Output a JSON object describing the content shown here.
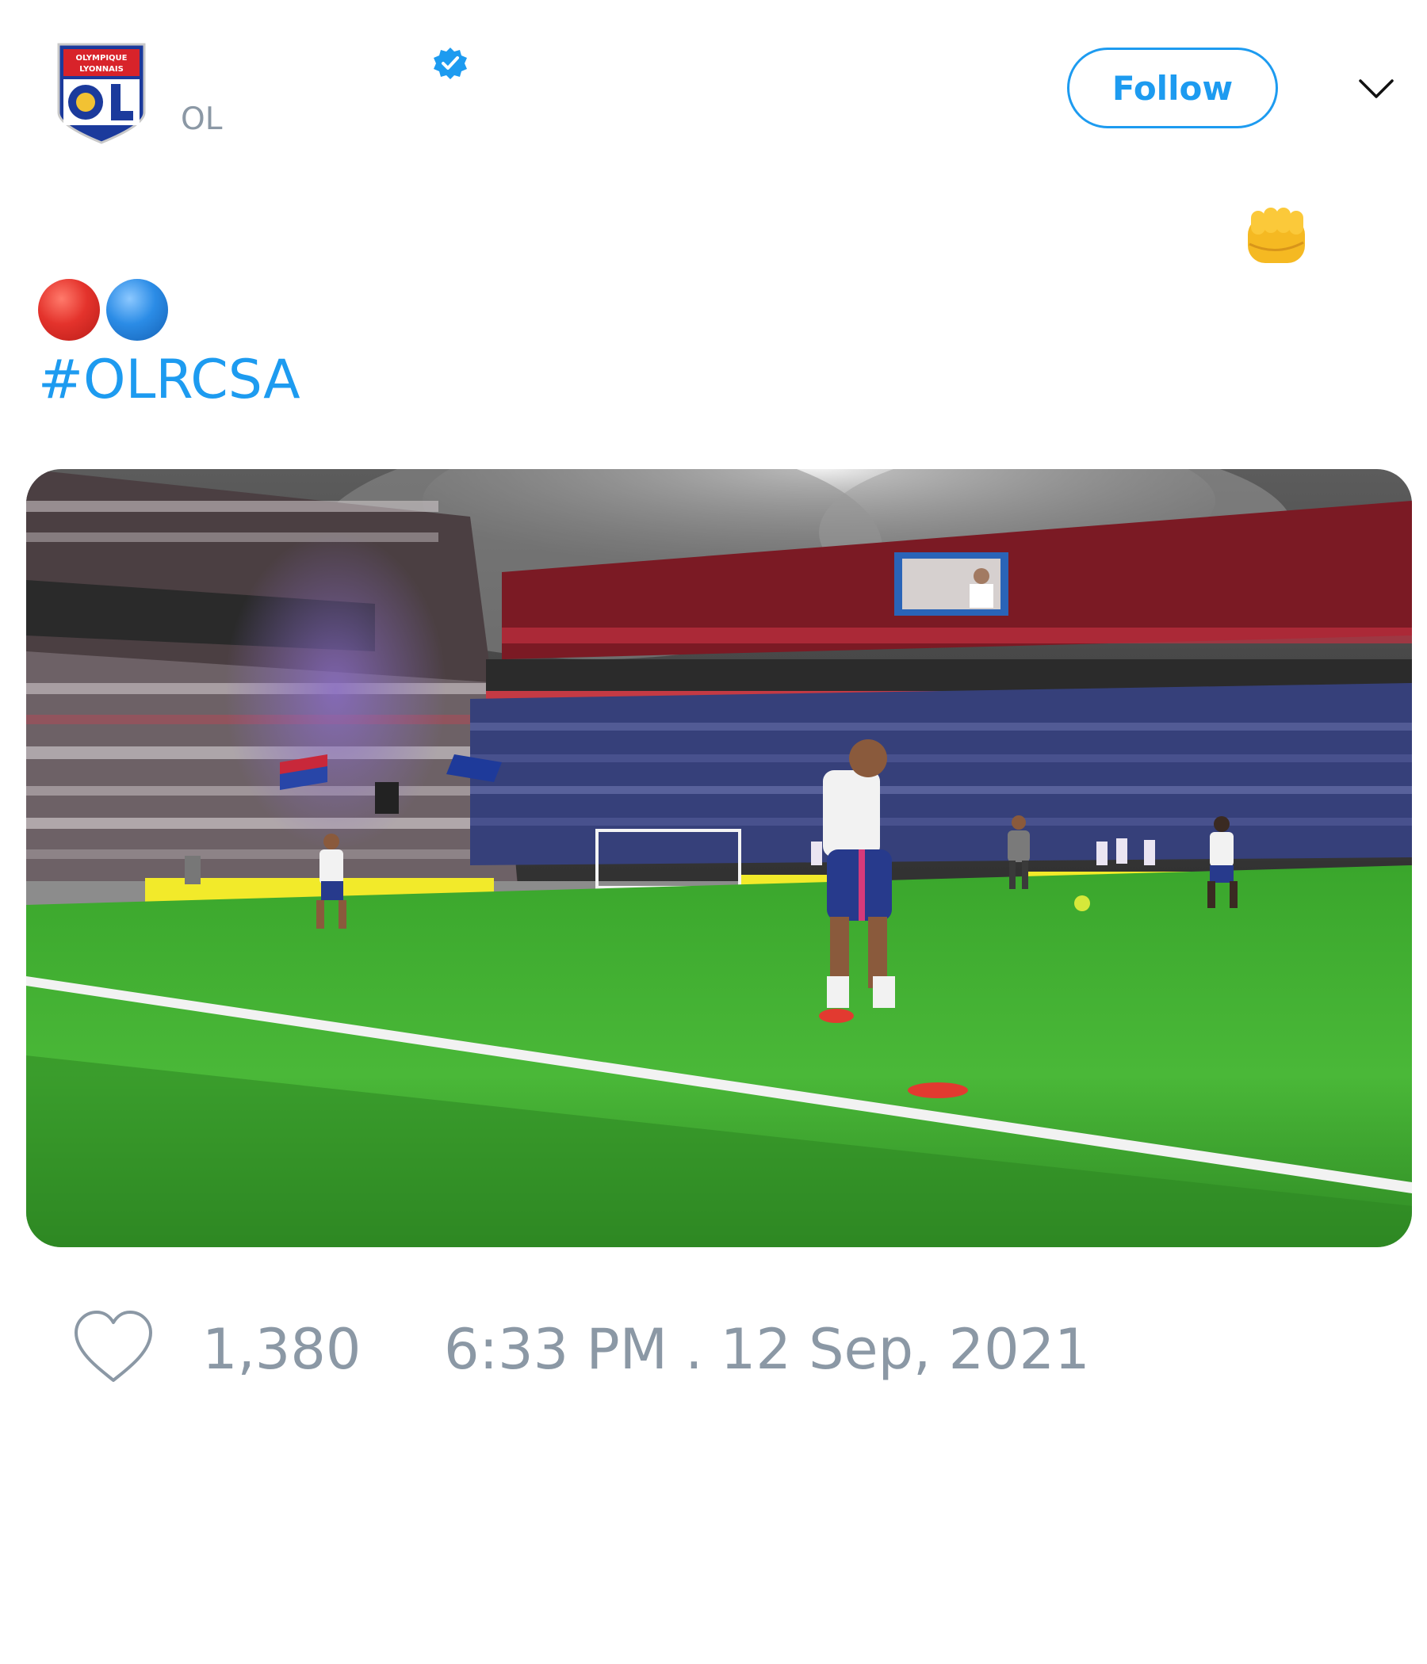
{
  "header": {
    "display_name": "",
    "handle": "OL",
    "avatar_icon": "ol-club-crest-icon",
    "verified_icon": "verified-badge-icon",
    "follow_label": "Follow",
    "menu_icon": "chevron-down-icon",
    "crest_text": [
      "OLYMPIQUE",
      "LYONNAIS",
      "OL"
    ]
  },
  "tweet": {
    "text_emoji_icon": "oncoming-fist-icon",
    "color_dots": [
      "red-circle-icon",
      "blue-circle-icon"
    ],
    "hashtag": "#OLRCSA"
  },
  "media": {
    "type": "video",
    "description_icon": "stadium-warmup-video-frame"
  },
  "footer": {
    "like_icon": "heart-icon",
    "like_count": "1,380",
    "timestamp": "6:33 PM . 12 Sep, 2021"
  },
  "colors": {
    "accent": "#1d9bf0",
    "muted_text": "#8b98a5",
    "background": "#ffffff"
  }
}
